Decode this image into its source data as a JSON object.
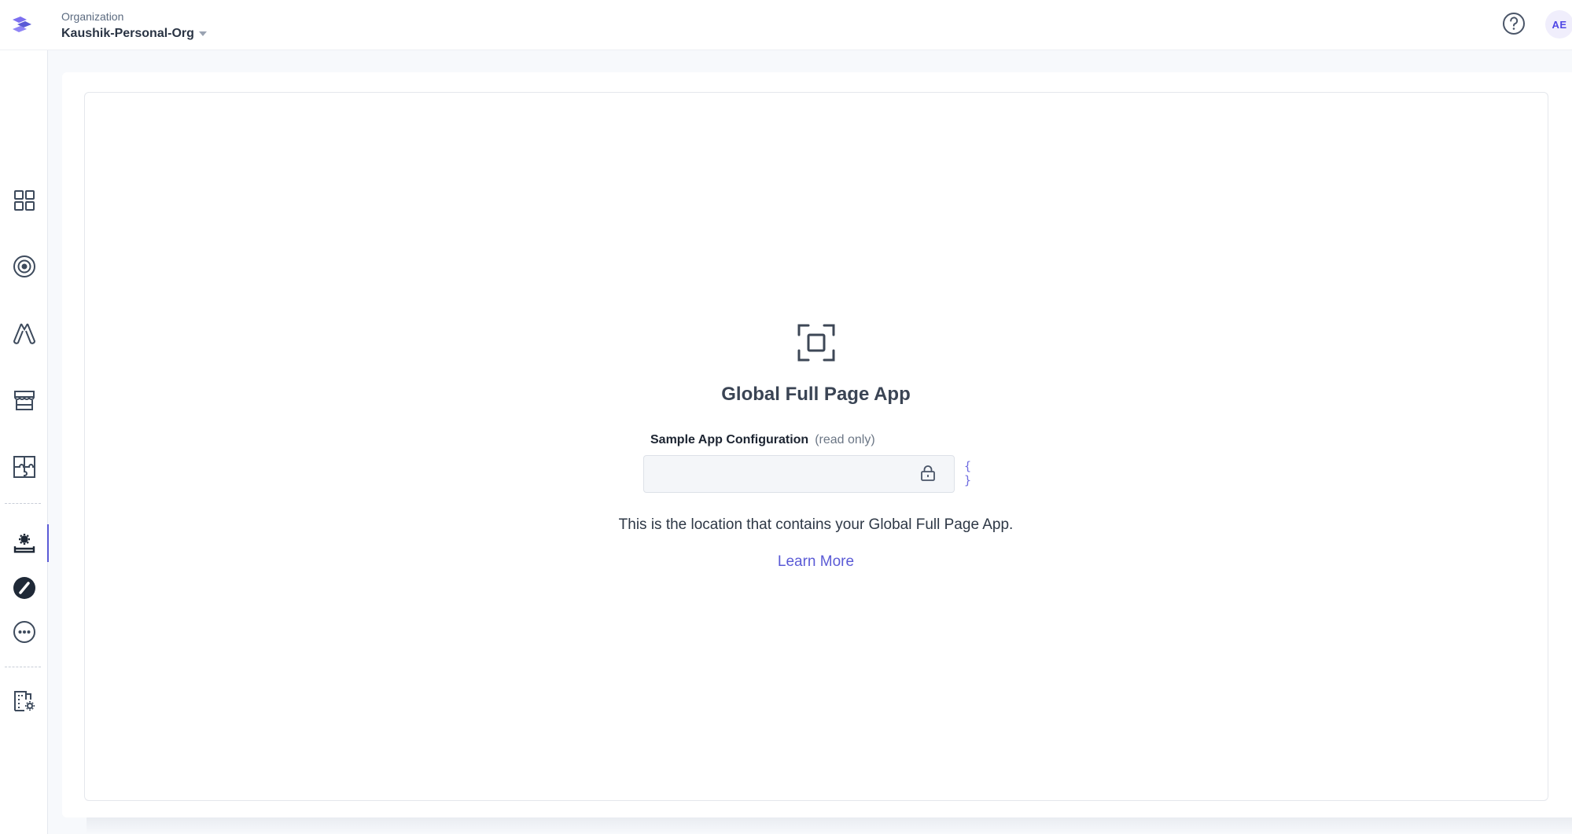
{
  "header": {
    "org_label": "Organization",
    "org_name": "Kaushik-Personal-Org",
    "avatar_initials": "AE"
  },
  "sidebar": {
    "items": [
      {
        "icon": "grid-icon"
      },
      {
        "icon": "target-icon"
      },
      {
        "icon": "triangle-rings-icon"
      },
      {
        "icon": "storefront-icon"
      },
      {
        "icon": "puzzle-icon"
      },
      {
        "icon": "app-settings-icon",
        "active": true
      },
      {
        "icon": "slash-circle-icon"
      },
      {
        "icon": "more-icon"
      },
      {
        "icon": "building-settings-icon"
      }
    ]
  },
  "main": {
    "app_title": "Global Full Page App",
    "config_label": "Sample App Configuration",
    "config_hint": "(read only)",
    "config_value": "",
    "json_toggle": "{ }",
    "description": "This is the location that contains your Global Full Page App.",
    "learn_more": "Learn More"
  },
  "colors": {
    "accent": "#5b5bd6",
    "icon": "#3d4a5c",
    "background": "#f7f9fc"
  }
}
